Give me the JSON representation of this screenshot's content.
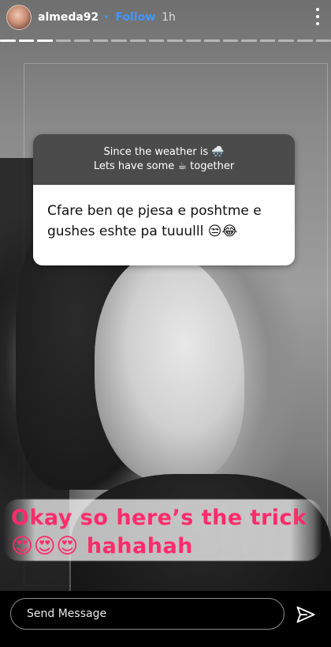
{
  "header": {
    "username": "almeda92",
    "follow_label": "Follow",
    "separator": "•",
    "time": "1h"
  },
  "question": {
    "prompt_line1": "Since the weather is 🌨️",
    "prompt_line2": "Lets have some ☕ together",
    "answer": "Cfare ben qe pjesa e poshtme e gushes eshte pa tuuulll 😒😂"
  },
  "caption": {
    "line1": "Okay so here’s the trick",
    "line2": "😍😍😍 hahahah"
  },
  "composer": {
    "placeholder": "Send Message"
  },
  "icons": [
    "avatar",
    "more-icon",
    "send-icon"
  ],
  "colors": {
    "follow_blue": "#3f96ff",
    "caption_pink": "#ff2b6b"
  }
}
